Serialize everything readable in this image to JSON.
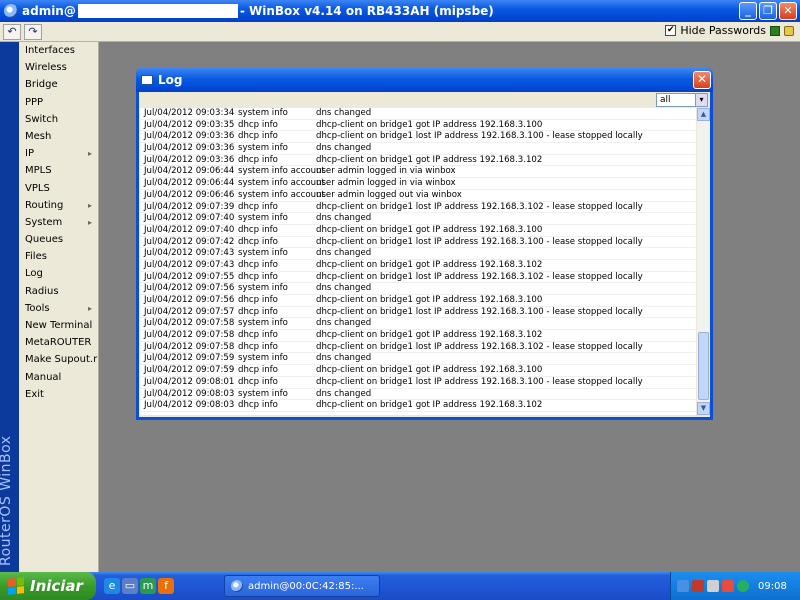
{
  "window": {
    "title_prefix": "admin@",
    "title_suffix": "- WinBox v4.14 on RB433AH (mipsbe)",
    "controls": [
      "_",
      "❐",
      "✕"
    ]
  },
  "toolbar": {
    "undo": "↶",
    "redo": "↷",
    "hide_passwords_label": "Hide Passwords",
    "hide_passwords_checked": "✔"
  },
  "banner": {
    "text": "RouterOS WinBox"
  },
  "menu": {
    "items": [
      {
        "label": "Interfaces",
        "arrow": ""
      },
      {
        "label": "Wireless",
        "arrow": ""
      },
      {
        "label": "Bridge",
        "arrow": ""
      },
      {
        "label": "PPP",
        "arrow": ""
      },
      {
        "label": "Switch",
        "arrow": ""
      },
      {
        "label": "Mesh",
        "arrow": ""
      },
      {
        "label": "IP",
        "arrow": "▸"
      },
      {
        "label": "MPLS",
        "arrow": ""
      },
      {
        "label": "VPLS",
        "arrow": ""
      },
      {
        "label": "Routing",
        "arrow": "▸"
      },
      {
        "label": "System",
        "arrow": "▸"
      },
      {
        "label": "Queues",
        "arrow": ""
      },
      {
        "label": "Files",
        "arrow": ""
      },
      {
        "label": "Log",
        "arrow": ""
      },
      {
        "label": "Radius",
        "arrow": ""
      },
      {
        "label": "Tools",
        "arrow": "▸"
      },
      {
        "label": "New Terminal",
        "arrow": ""
      },
      {
        "label": "MetaROUTER",
        "arrow": ""
      },
      {
        "label": "Make Supout.rif",
        "arrow": ""
      },
      {
        "label": "Manual",
        "arrow": ""
      },
      {
        "label": "Exit",
        "arrow": ""
      }
    ]
  },
  "log": {
    "title": "Log",
    "close": "✕",
    "filter_value": "all",
    "filter_arrow": "▾",
    "rows": [
      {
        "time": "Jul/04/2012 09:03:34",
        "topic": "system info",
        "message": "dns changed"
      },
      {
        "time": "Jul/04/2012 09:03:35",
        "topic": "dhcp info",
        "message": "dhcp-client on bridge1 got IP address 192.168.3.100"
      },
      {
        "time": "Jul/04/2012 09:03:36",
        "topic": "dhcp info",
        "message": "dhcp-client on bridge1 lost IP address 192.168.3.100 - lease stopped locally"
      },
      {
        "time": "Jul/04/2012 09:03:36",
        "topic": "system info",
        "message": "dns changed"
      },
      {
        "time": "Jul/04/2012 09:03:36",
        "topic": "dhcp info",
        "message": "dhcp-client on bridge1 got IP address 192.168.3.102"
      },
      {
        "time": "Jul/04/2012 09:06:44",
        "topic": "system info account",
        "message": "user admin logged in via winbox"
      },
      {
        "time": "Jul/04/2012 09:06:44",
        "topic": "system info account",
        "message": "user admin logged in via winbox"
      },
      {
        "time": "Jul/04/2012 09:06:46",
        "topic": "system info account",
        "message": "user admin logged out via winbox"
      },
      {
        "time": "Jul/04/2012 09:07:39",
        "topic": "dhcp info",
        "message": "dhcp-client on bridge1 lost IP address 192.168.3.102 - lease stopped locally"
      },
      {
        "time": "Jul/04/2012 09:07:40",
        "topic": "system info",
        "message": "dns changed"
      },
      {
        "time": "Jul/04/2012 09:07:40",
        "topic": "dhcp info",
        "message": "dhcp-client on bridge1 got IP address 192.168.3.100"
      },
      {
        "time": "Jul/04/2012 09:07:42",
        "topic": "dhcp info",
        "message": "dhcp-client on bridge1 lost IP address 192.168.3.100 - lease stopped locally"
      },
      {
        "time": "Jul/04/2012 09:07:43",
        "topic": "system info",
        "message": "dns changed"
      },
      {
        "time": "Jul/04/2012 09:07:43",
        "topic": "dhcp info",
        "message": "dhcp-client on bridge1 got IP address 192.168.3.102"
      },
      {
        "time": "Jul/04/2012 09:07:55",
        "topic": "dhcp info",
        "message": "dhcp-client on bridge1 lost IP address 192.168.3.102 - lease stopped locally"
      },
      {
        "time": "Jul/04/2012 09:07:56",
        "topic": "system info",
        "message": "dns changed"
      },
      {
        "time": "Jul/04/2012 09:07:56",
        "topic": "dhcp info",
        "message": "dhcp-client on bridge1 got IP address 192.168.3.100"
      },
      {
        "time": "Jul/04/2012 09:07:57",
        "topic": "dhcp info",
        "message": "dhcp-client on bridge1 lost IP address 192.168.3.100 - lease stopped locally"
      },
      {
        "time": "Jul/04/2012 09:07:58",
        "topic": "system info",
        "message": "dns changed"
      },
      {
        "time": "Jul/04/2012 09:07:58",
        "topic": "dhcp info",
        "message": "dhcp-client on bridge1 got IP address 192.168.3.102"
      },
      {
        "time": "Jul/04/2012 09:07:58",
        "topic": "dhcp info",
        "message": "dhcp-client on bridge1 lost IP address 192.168.3.102 - lease stopped locally"
      },
      {
        "time": "Jul/04/2012 09:07:59",
        "topic": "system info",
        "message": "dns changed"
      },
      {
        "time": "Jul/04/2012 09:07:59",
        "topic": "dhcp info",
        "message": "dhcp-client on bridge1 got IP address 192.168.3.100"
      },
      {
        "time": "Jul/04/2012 09:08:01",
        "topic": "dhcp info",
        "message": "dhcp-client on bridge1 lost IP address 192.168.3.100 - lease stopped locally"
      },
      {
        "time": "Jul/04/2012 09:08:03",
        "topic": "system info",
        "message": "dns changed"
      },
      {
        "time": "Jul/04/2012 09:08:03",
        "topic": "dhcp info",
        "message": "dhcp-client on bridge1 got IP address 192.168.3.102"
      }
    ]
  },
  "taskbar": {
    "start_label": "Iniciar",
    "task_label": "admin@00:0C:42:85:...",
    "clock": "09:08"
  },
  "colors": {
    "xp_blue": "#0a5ae0",
    "start_green": "#3a9a2a",
    "banner_blue": "#0c3a9c",
    "menu_bg": "#ece9d8"
  },
  "icons": {
    "app": "winbox-icon",
    "quick_launch": [
      "ie-icon",
      "show-desktop-icon",
      "mozilla-icon",
      "firefox-icon"
    ],
    "tray": [
      "network-icon",
      "security-icon",
      "volume-icon",
      "antivirus-icon",
      "update-icon"
    ]
  }
}
